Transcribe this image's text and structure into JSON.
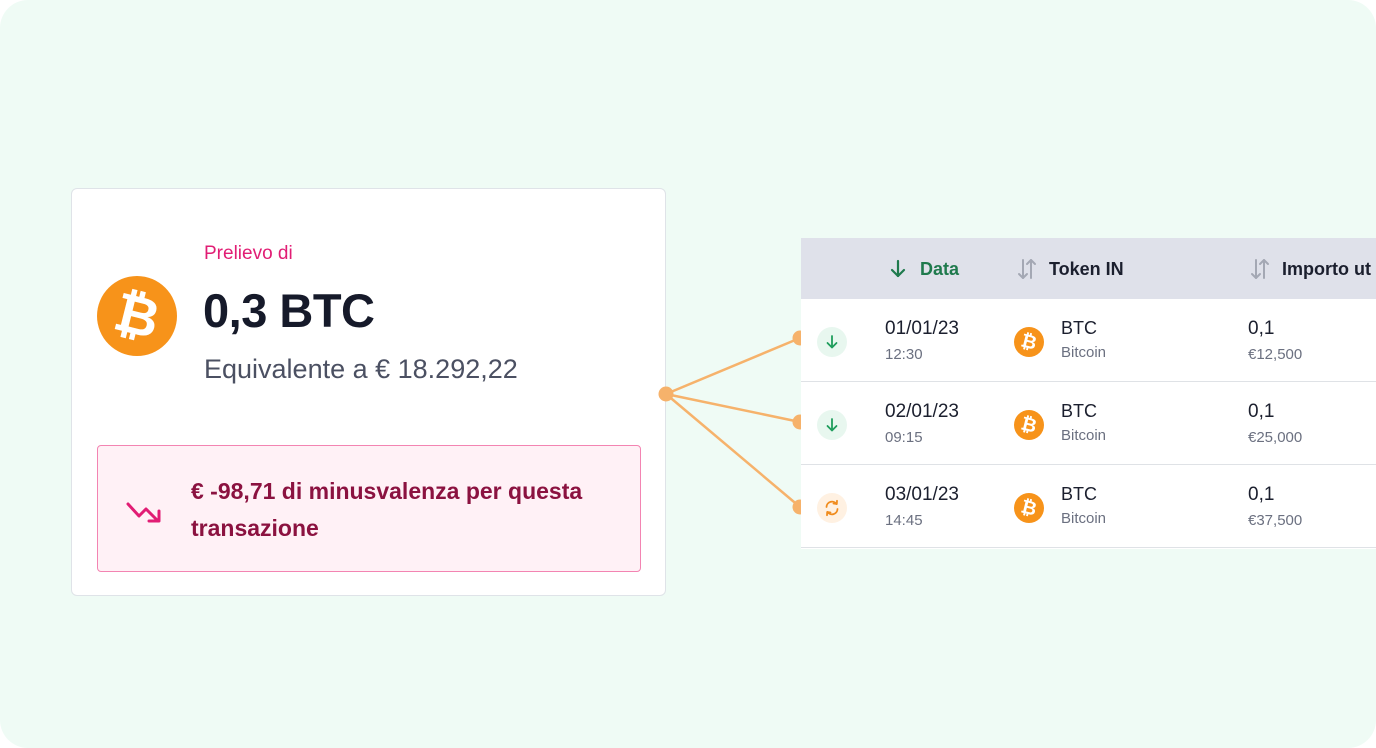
{
  "card": {
    "subtitle": "Prelievo di",
    "amount": "0,3 BTC",
    "equivalent": "Equivalente a € 18.292,22",
    "coin_symbol": "₿",
    "loss_text": "€ -98,71 di minusvalenza per questa transazione"
  },
  "table": {
    "headers": {
      "date": "Data",
      "token_in": "Token IN",
      "importo": "Importo ut"
    },
    "rows": [
      {
        "status": "incoming",
        "date": "01/01/23",
        "time": "12:30",
        "coin_symbol": "₿",
        "token": "BTC",
        "token_name": "Bitcoin",
        "qty": "0,1",
        "eur": "€12,500"
      },
      {
        "status": "incoming",
        "date": "02/01/23",
        "time": "09:15",
        "coin_symbol": "₿",
        "token": "BTC",
        "token_name": "Bitcoin",
        "qty": "0,1",
        "eur": "€25,000"
      },
      {
        "status": "swap",
        "date": "03/01/23",
        "time": "14:45",
        "coin_symbol": "₿",
        "token": "BTC",
        "token_name": "Bitcoin",
        "qty": "0,1",
        "eur": "€37,500"
      }
    ]
  },
  "colors": {
    "background": "#effbf5",
    "bitcoin": "#f7931a",
    "connector": "#f6b26b",
    "accent_pink": "#e11d74",
    "loss_text": "#8b1240",
    "sort_active": "#1f7a4d"
  }
}
